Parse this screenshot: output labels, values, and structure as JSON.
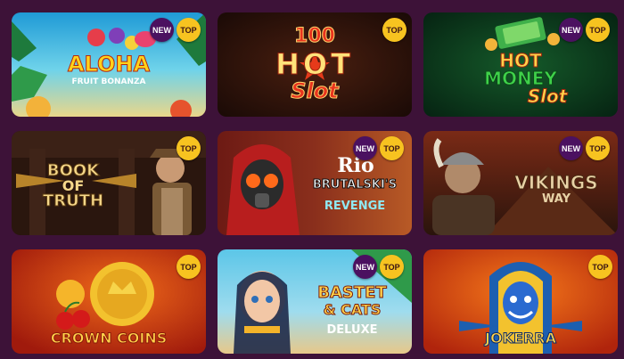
{
  "badges": {
    "new": "NEW",
    "top": "TOP"
  },
  "colors": {
    "background": "#3d1238",
    "new_badge": "#4b1160",
    "top_badge": "#f7c320"
  },
  "games": [
    {
      "id": "aloha",
      "title_line1": "ALOHA",
      "title_line2": "FRUIT BONANZA",
      "badges": [
        "NEW",
        "TOP"
      ]
    },
    {
      "id": "hot-slot",
      "title_line1": "100",
      "title_line2": "HOT",
      "title_line3": "Slot",
      "badges": [
        "TOP"
      ]
    },
    {
      "id": "hot-money",
      "title_line1": "HOT",
      "title_line2": "MONEY",
      "title_line3": "Slot",
      "badges": [
        "NEW",
        "TOP"
      ]
    },
    {
      "id": "book-of-truth",
      "title_line1": "BOOK",
      "title_line2": "OF",
      "title_line3": "TRUTH",
      "badges": [
        "TOP"
      ]
    },
    {
      "id": "rio",
      "title_line1": "Rio",
      "title_line2": "BRUTALSKI'S",
      "title_line3": "REVENGE",
      "badges": [
        "NEW",
        "TOP"
      ]
    },
    {
      "id": "vikings-way",
      "title_line1": "VIKINGS",
      "title_line2": "WAY",
      "badges": [
        "NEW",
        "TOP"
      ]
    },
    {
      "id": "crown-coins",
      "title_line1": "CROWN COINS",
      "badges": [
        "TOP"
      ]
    },
    {
      "id": "bastet-cats",
      "title_line1": "BASTET",
      "title_line2": "& CATS",
      "title_line3": "DELUXE",
      "badges": [
        "NEW",
        "TOP"
      ]
    },
    {
      "id": "jokerra",
      "title_line1": "JOKERRA",
      "badges": [
        "TOP"
      ]
    }
  ]
}
